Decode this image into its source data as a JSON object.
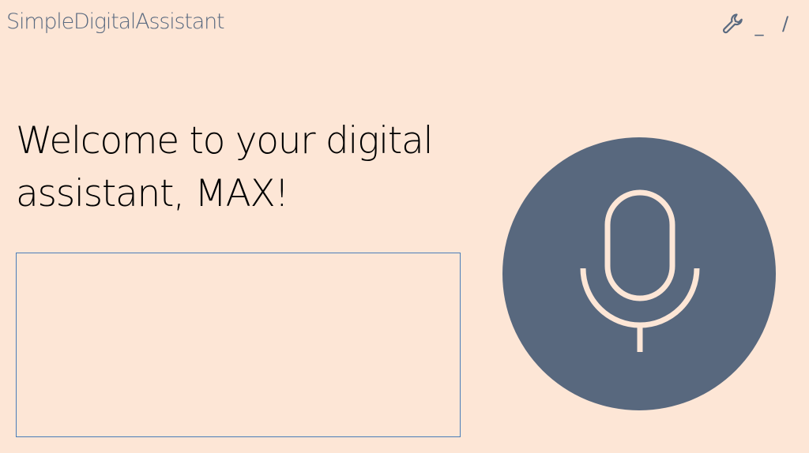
{
  "app": {
    "title": "SimpleDigitalAssistant"
  },
  "window_controls": {
    "settings_icon": "wrench-icon",
    "minimize_label": "_",
    "restore_label": "/"
  },
  "main": {
    "welcome_line1": "Welcome to your digital",
    "welcome_line2": "assistant, MAX!",
    "transcript_text": ""
  },
  "mic": {
    "icon": "microphone-icon",
    "button_color": "#58687e",
    "icon_color": "#fde6d6"
  },
  "colors": {
    "background": "#fde6d6",
    "title_text": "#5a6a80",
    "box_border": "#4a7db8"
  }
}
